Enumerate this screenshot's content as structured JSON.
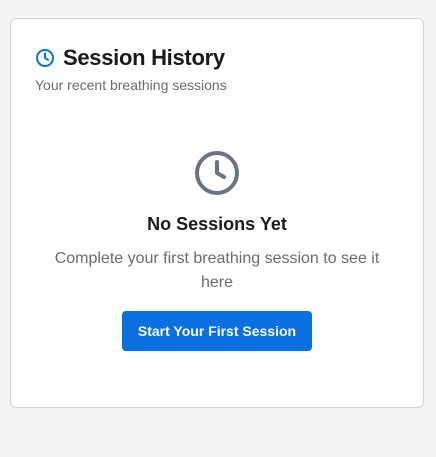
{
  "card": {
    "title": "Session History",
    "subtitle": "Your recent breathing sessions",
    "title_icon": "clock-icon"
  },
  "empty_state": {
    "icon": "clock-icon",
    "title": "No Sessions Yet",
    "message": "Complete your first breathing session to see it here",
    "button_label": "Start Your First Session"
  },
  "colors": {
    "accent": "#0b6fe0",
    "icon_gray": "#6b7280",
    "text_primary": "#1a1a1a",
    "text_secondary": "#6b6b6b",
    "border": "#d4d4d4",
    "background": "#f5f5f5"
  }
}
